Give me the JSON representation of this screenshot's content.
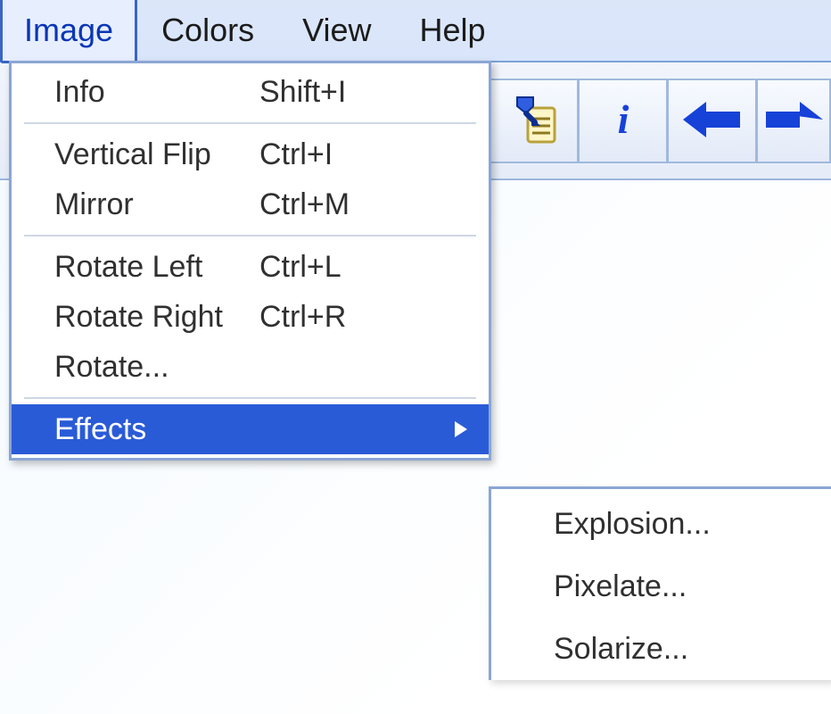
{
  "menubar": {
    "items": [
      {
        "label": "Image",
        "open": true
      },
      {
        "label": "Colors",
        "open": false
      },
      {
        "label": "View",
        "open": false
      },
      {
        "label": "Help",
        "open": false
      }
    ]
  },
  "toolbar": {
    "buttons": [
      {
        "name": "paste-icon"
      },
      {
        "name": "info-icon"
      },
      {
        "name": "prev-icon"
      },
      {
        "name": "next-icon"
      }
    ]
  },
  "imageMenu": {
    "groups": [
      [
        {
          "label": "Info",
          "accel": "Shift+I",
          "hasSub": false,
          "selected": false
        }
      ],
      [
        {
          "label": "Vertical Flip",
          "accel": "Ctrl+I",
          "hasSub": false,
          "selected": false
        },
        {
          "label": "Mirror",
          "accel": "Ctrl+M",
          "hasSub": false,
          "selected": false
        }
      ],
      [
        {
          "label": "Rotate Left",
          "accel": "Ctrl+L",
          "hasSub": false,
          "selected": false
        },
        {
          "label": "Rotate Right",
          "accel": "Ctrl+R",
          "hasSub": false,
          "selected": false
        },
        {
          "label": "Rotate...",
          "accel": "",
          "hasSub": false,
          "selected": false
        }
      ],
      [
        {
          "label": "Effects",
          "accel": "",
          "hasSub": true,
          "selected": true
        }
      ]
    ]
  },
  "effectsSubmenu": {
    "items": [
      {
        "label": "Explosion..."
      },
      {
        "label": "Pixelate..."
      },
      {
        "label": "Solarize..."
      }
    ]
  }
}
